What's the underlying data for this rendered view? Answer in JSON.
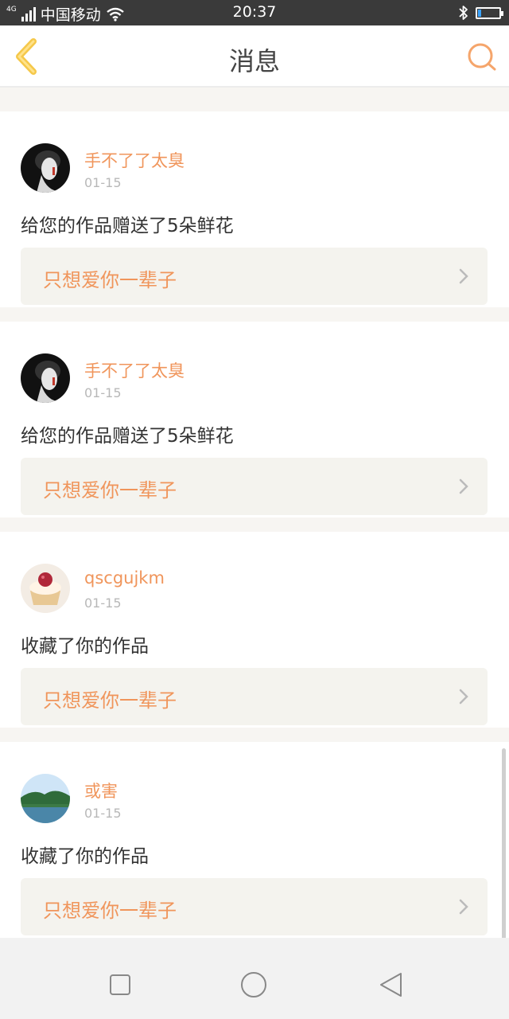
{
  "status_bar": {
    "network_badge": "4G",
    "carrier": "中国移动",
    "time": "20:37",
    "battery_level": 0.15
  },
  "header": {
    "title": "消息"
  },
  "messages": [
    {
      "username": "手不了了太臭",
      "date": "01-15",
      "action": "给您的作品赠送了5朵鲜花",
      "work_title": "只想爱你一辈子",
      "avatar": "dark-portrait"
    },
    {
      "username": "手不了了太臭",
      "date": "01-15",
      "action": "给您的作品赠送了5朵鲜花",
      "work_title": "只想爱你一辈子",
      "avatar": "dark-portrait"
    },
    {
      "username": "qscgujkm",
      "date": "01-15",
      "action": "收藏了你的作品",
      "work_title": "只想爱你一辈子",
      "avatar": "cupcake"
    },
    {
      "username": "或害",
      "date": "01-15",
      "action": "收藏了你的作品",
      "work_title": "只想爱你一辈子",
      "avatar": "landscape"
    }
  ],
  "colors": {
    "accent": "#f0955b",
    "back_arrow": "#f5c84a",
    "card_link_bg": "#f4f3ee"
  },
  "icons": {
    "back": "chevron-left-icon",
    "search": "search-icon",
    "recent": "square-icon",
    "home": "circle-icon",
    "back_nav": "triangle-back-icon"
  }
}
